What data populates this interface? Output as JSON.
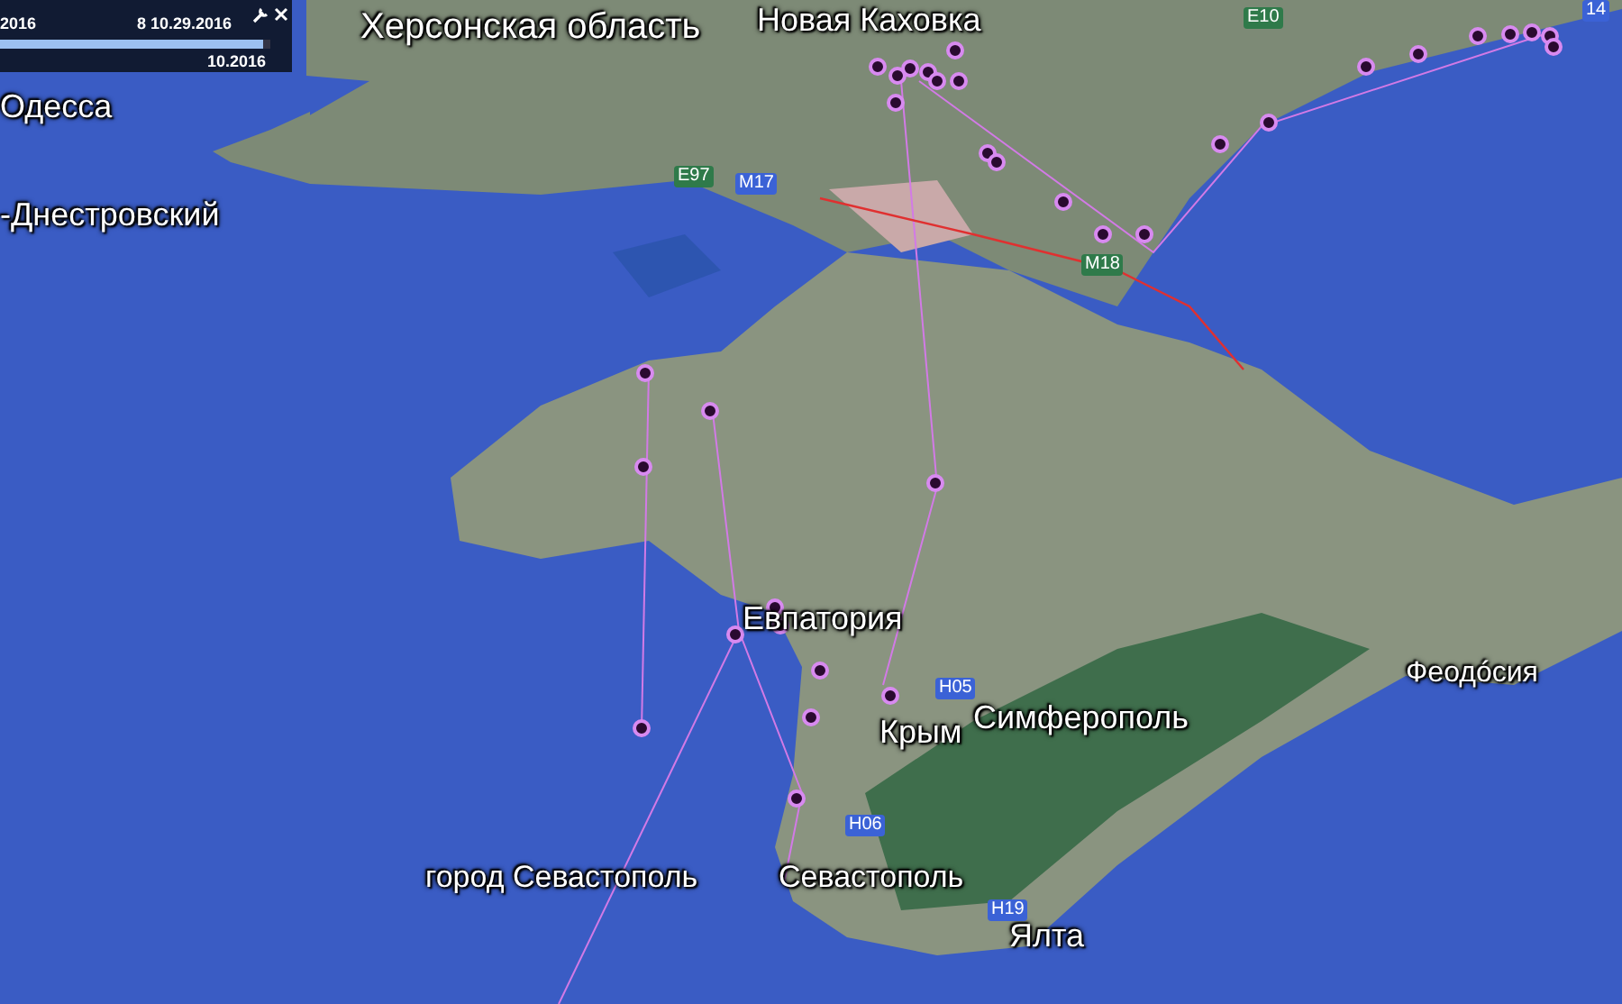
{
  "time_slider": {
    "start_label": "2016",
    "current_label": "8 10.29.2016",
    "end_label": "10.2016",
    "level": 0.97
  },
  "place_labels": [
    {
      "text": "Херсонская область"
    },
    {
      "text": "Новая Каховка"
    },
    {
      "text": "Одесса"
    },
    {
      "text": "-Днестровский"
    },
    {
      "text": "Евпатория"
    },
    {
      "text": "Крым"
    },
    {
      "text": "Симферополь"
    },
    {
      "text": "Феодóсия"
    },
    {
      "text": "город Севастополь"
    },
    {
      "text": "Севастополь"
    },
    {
      "text": "Ялта"
    }
  ],
  "road_labels": [
    {
      "text": "E97",
      "kind": "european"
    },
    {
      "text": "M17",
      "kind": "national"
    },
    {
      "text": "M18",
      "kind": "european"
    },
    {
      "text": "E10",
      "kind": "european"
    },
    {
      "text": "H05",
      "kind": "national"
    },
    {
      "text": "H06",
      "kind": "national"
    },
    {
      "text": "H19",
      "kind": "national"
    },
    {
      "text": "14",
      "kind": "national"
    }
  ]
}
